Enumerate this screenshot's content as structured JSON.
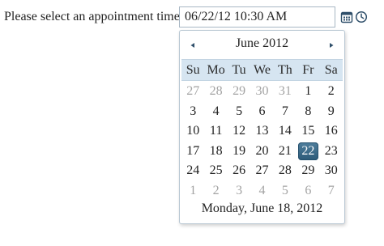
{
  "form": {
    "prompt_label": "Please select an appointment time:",
    "input_value": "06/22/12 10:30 AM"
  },
  "icons": {
    "calendar_button": "calendar-icon",
    "clock_button": "clock-icon",
    "prev_month": "triangle-left-icon",
    "next_month": "triangle-right-icon"
  },
  "colors": {
    "selected_bg": "#2f5e7d",
    "weekday_header_bg": "#d6e5f1",
    "other_month_text": "#a3a3a3",
    "border": "#b8c7d3"
  },
  "calendar": {
    "month_title": "June 2012",
    "weekdays": [
      "Su",
      "Mo",
      "Tu",
      "We",
      "Th",
      "Fr",
      "Sa"
    ],
    "weeks": [
      [
        {
          "d": "27",
          "other": true
        },
        {
          "d": "28",
          "other": true
        },
        {
          "d": "29",
          "other": true
        },
        {
          "d": "30",
          "other": true
        },
        {
          "d": "31",
          "other": true
        },
        {
          "d": "1"
        },
        {
          "d": "2"
        }
      ],
      [
        {
          "d": "3"
        },
        {
          "d": "4"
        },
        {
          "d": "5"
        },
        {
          "d": "6"
        },
        {
          "d": "7"
        },
        {
          "d": "8"
        },
        {
          "d": "9"
        }
      ],
      [
        {
          "d": "10"
        },
        {
          "d": "11"
        },
        {
          "d": "12"
        },
        {
          "d": "13"
        },
        {
          "d": "14"
        },
        {
          "d": "15"
        },
        {
          "d": "16"
        }
      ],
      [
        {
          "d": "17"
        },
        {
          "d": "18"
        },
        {
          "d": "19"
        },
        {
          "d": "20"
        },
        {
          "d": "21"
        },
        {
          "d": "22",
          "selected": true
        },
        {
          "d": "23"
        }
      ],
      [
        {
          "d": "24"
        },
        {
          "d": "25"
        },
        {
          "d": "26"
        },
        {
          "d": "27"
        },
        {
          "d": "28"
        },
        {
          "d": "29"
        },
        {
          "d": "30"
        }
      ],
      [
        {
          "d": "1",
          "other": true
        },
        {
          "d": "2",
          "other": true
        },
        {
          "d": "3",
          "other": true
        },
        {
          "d": "4",
          "other": true
        },
        {
          "d": "5",
          "other": true
        },
        {
          "d": "6",
          "other": true
        },
        {
          "d": "7",
          "other": true
        }
      ]
    ],
    "footer_today": "Monday, June 18, 2012"
  }
}
